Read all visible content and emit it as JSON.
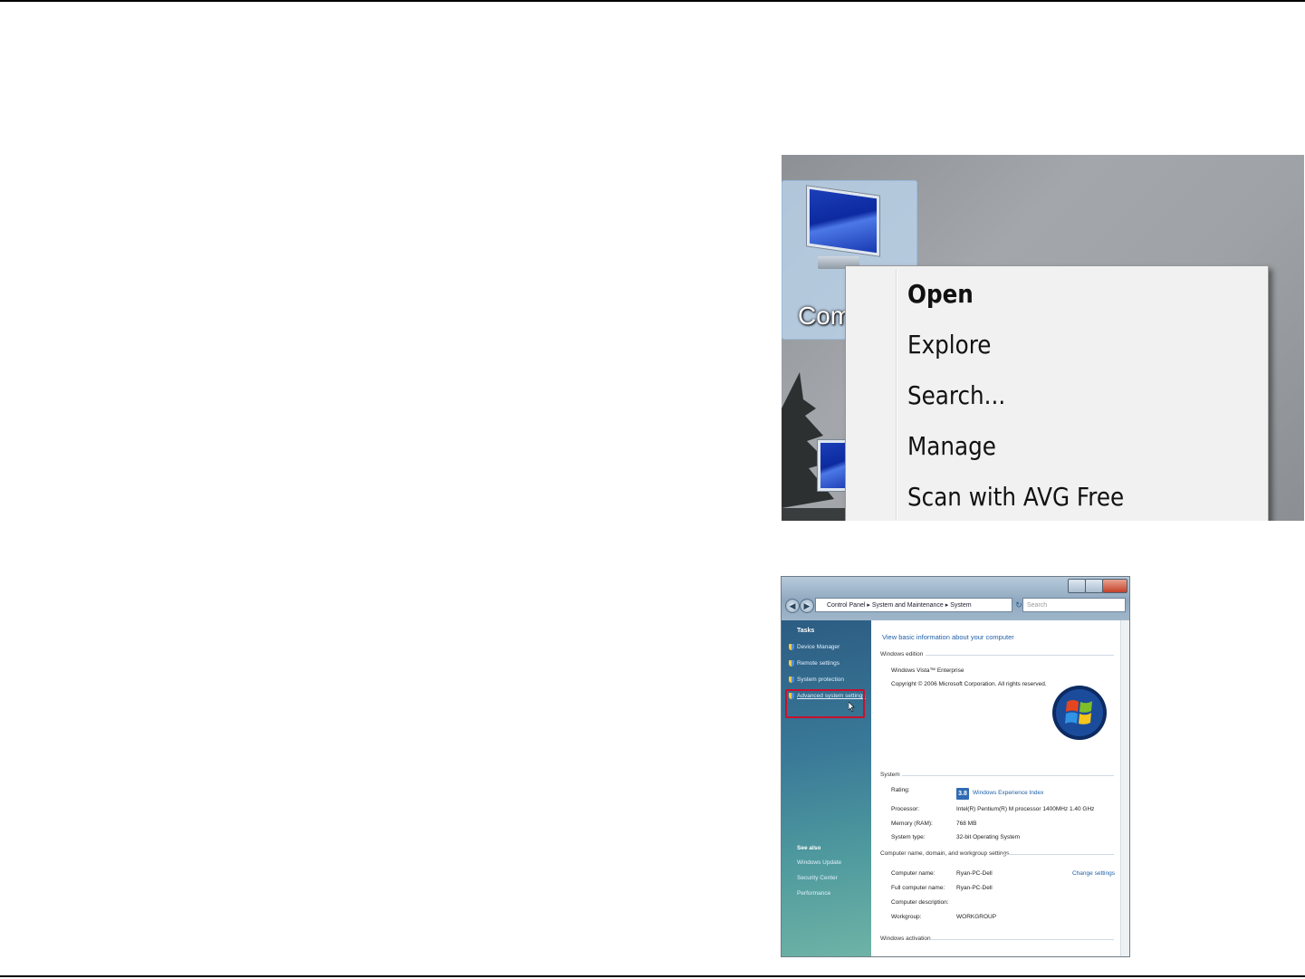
{
  "context_screenshot": {
    "desktop_icon_label": "Com",
    "menu_items": [
      {
        "label": "Open",
        "bold": true
      },
      {
        "label": "Explore",
        "bold": false
      },
      {
        "label": "Search...",
        "bold": false
      },
      {
        "label": "Manage",
        "bold": false
      },
      {
        "label": "Scan with AVG Free",
        "bold": false
      }
    ]
  },
  "system_window": {
    "address": "Control Panel ▸ System and Maintenance ▸ System",
    "search_placeholder": "Search",
    "tasks": {
      "heading": "Tasks",
      "links": [
        "Device Manager",
        "Remote settings",
        "System protection",
        "Advanced system settings"
      ]
    },
    "see_also": {
      "heading": "See also",
      "links": [
        "Windows Update",
        "Security Center",
        "Performance"
      ]
    },
    "heading": "View basic information about your computer",
    "windows_edition": {
      "title": "Windows edition",
      "edition": "Windows Vista™ Enterprise",
      "copyright": "Copyright © 2006 Microsoft Corporation.  All rights reserved."
    },
    "system": {
      "title": "System",
      "rating_label": "Rating:",
      "rating_value": "3.8",
      "rating_link": "Windows Experience Index",
      "processor_label": "Processor:",
      "processor_value": "Intel(R) Pentium(R) M processor 1400MHz  1.40 GHz",
      "memory_label": "Memory (RAM):",
      "memory_value": "768 MB",
      "type_label": "System type:",
      "type_value": "32-bit Operating System"
    },
    "computer_name": {
      "title": "Computer name, domain, and workgroup settings",
      "change_link": "Change settings",
      "name_label": "Computer name:",
      "name_value": "Ryan-PC-Dell",
      "full_label": "Full computer name:",
      "full_value": "Ryan-PC-Dell",
      "desc_label": "Computer description:",
      "wg_label": "Workgroup:",
      "wg_value": "WORKGROUP"
    },
    "activation_title": "Windows activation"
  },
  "colors": {
    "link": "#1f5fa8",
    "highlight_box": "#c8102e",
    "menu_background": "#f1f1f1"
  }
}
